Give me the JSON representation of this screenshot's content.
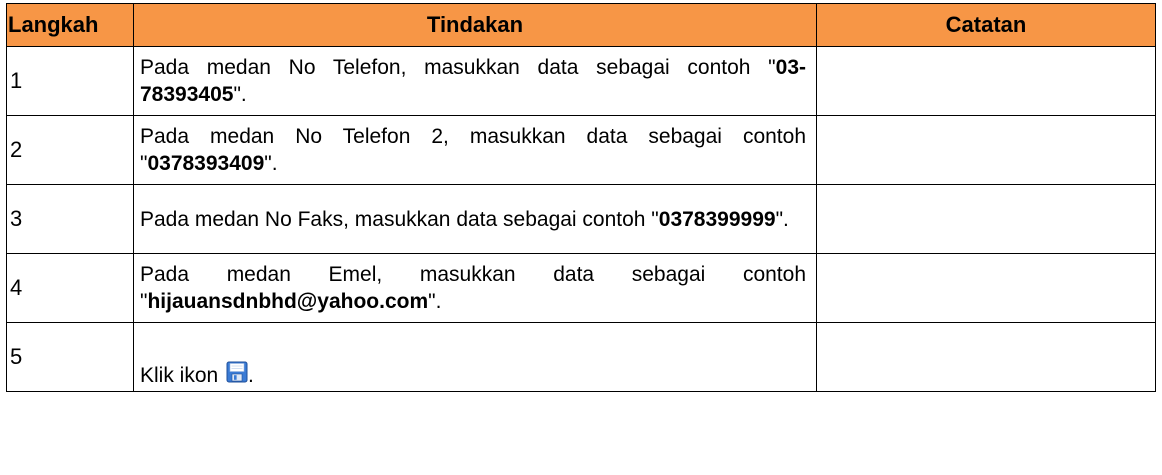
{
  "table": {
    "headers": {
      "step": "Langkah",
      "action": "Tindakan",
      "note": "Catatan"
    },
    "rows": [
      {
        "step": "1",
        "action_before": "Pada medan No Telefon, masukkan data sebagai contoh \"",
        "action_value": "03-78393405",
        "action_after": "\".",
        "note": ""
      },
      {
        "step": "2",
        "action_before": "Pada medan No Telefon 2, masukkan data sebagai contoh \"",
        "action_value": "0378393409",
        "action_after": "\".",
        "note": ""
      },
      {
        "step": "3",
        "action_before": "Pada medan No Faks, masukkan data sebagai contoh \"",
        "action_value": "0378399999",
        "action_after": "\".",
        "note": ""
      },
      {
        "step": "4",
        "action_before": "Pada medan Emel, masukkan data sebagai contoh \"",
        "action_value": "hijauansdnbhd@yahoo.com",
        "action_after": "\".",
        "note": ""
      },
      {
        "step": "5",
        "action_before": "Klik ikon ",
        "icon": "save-icon",
        "action_after": ".",
        "note": ""
      }
    ]
  },
  "colors": {
    "header_bg": "#f79646",
    "border": "#000000",
    "icon_blue": "#3a7bd5"
  }
}
